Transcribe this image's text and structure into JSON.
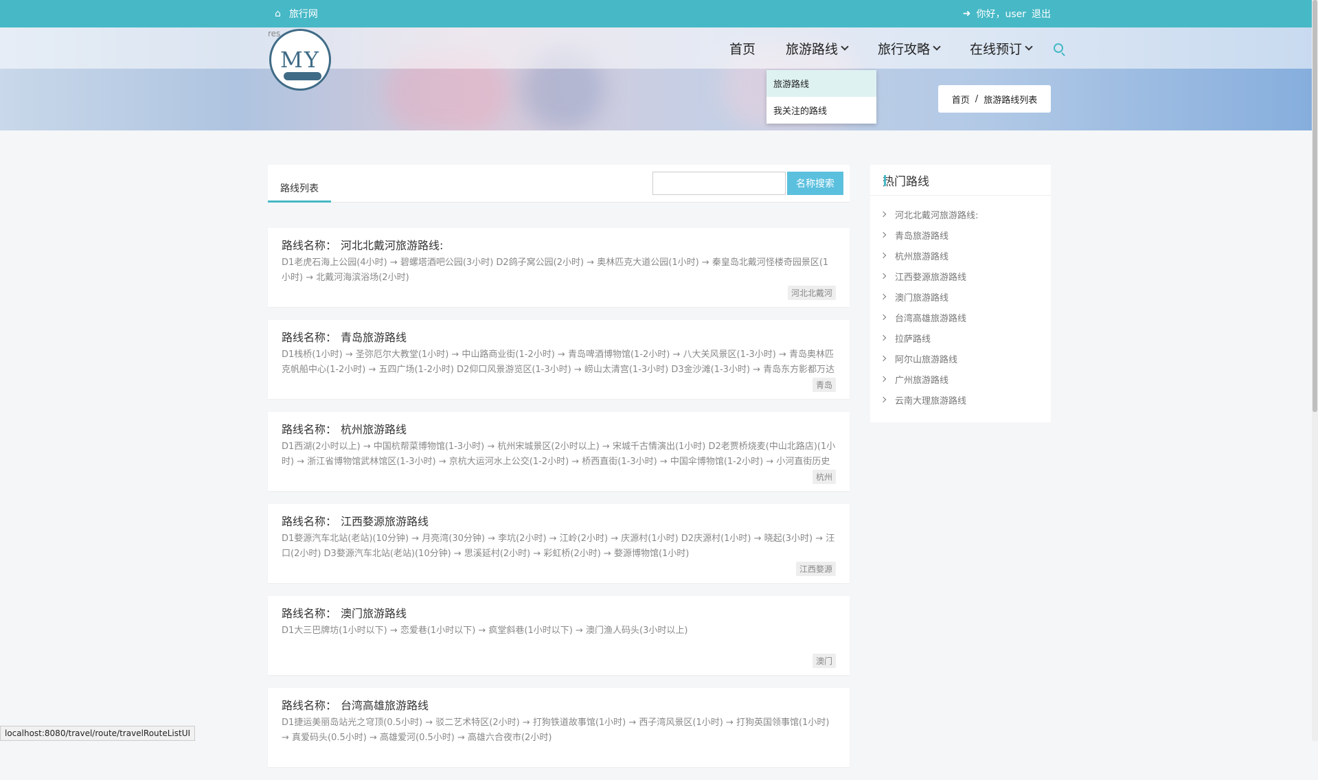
{
  "topbar": {
    "site_name": "旅行网",
    "greeting": "你好，user",
    "logout": "退出"
  },
  "logo": {
    "alt_text": "res",
    "mark": "MY"
  },
  "nav": {
    "home": "首页",
    "routes": "旅游路线",
    "guides": "旅行攻略",
    "booking": "在线预订"
  },
  "dropdown": {
    "options": [
      "旅游路线",
      "我关注的路线"
    ]
  },
  "breadcrumb": {
    "home": "首页",
    "separator": "/",
    "current": "旅游路线列表"
  },
  "main": {
    "tab": "路线列表",
    "search": {
      "placeholder": "",
      "button": "名称搜索"
    },
    "routes": [
      {
        "label": "路线名称：",
        "name": "河北北戴河旅游路线:",
        "desc": "D1老虎石海上公园(4小时) → 碧螺塔酒吧公园(3小时) D2鸽子窝公园(2小时) → 奥林匹克大道公园(1小时) → 秦皇岛北戴河怪楼奇园景区(1小时) → 北戴河海滨浴场(2小时)",
        "tag": "河北北戴河"
      },
      {
        "label": "路线名称：",
        "name": "青岛旅游路线",
        "desc": "D1栈桥(1小时) → 圣弥厄尔大教堂(1小时) → 中山路商业街(1-2小时) → 青岛啤酒博物馆(1-2小时) → 八大关风景区(1-3小时) → 青岛奥林匹克帆船中心(1-2小时) → 五四广场(1-2小时) D2仰口风景游览区(1-3小时) → 崂山太清宫(1-3小时) D3金沙滩(1-3小时) → 青岛东方影都万达乐园",
        "tag": "青岛"
      },
      {
        "label": "路线名称：",
        "name": "杭州旅游路线",
        "desc": "D1西湖(2小时以上) → 中国杭帮菜博物馆(1-3小时) → 杭州宋城景区(2小时以上) → 宋城千古情演出(1小时) D2老贾桥烧麦(中山北路店)(1小时) → 浙江省博物馆武林馆区(1-3小时) → 京杭大运河水上公交(1-2小时) → 桥西直街(1-3小时) → 中国伞博物馆(1-2小时) → 小河直街历史文",
        "tag": "杭州"
      },
      {
        "label": "路线名称：",
        "name": "江西婺源旅游路线",
        "desc": "D1婺源汽车北站(老站)(10分钟) → 月亮湾(30分钟) → 李坑(2小时) → 江岭(2小时) → 庆源村(1小时) D2庆源村(1小时) → 晓起(3小时) → 汪口(2小时) D3婺源汽车北站(老站)(10分钟) → 思溪延村(2小时) → 彩虹桥(2小时) → 婺源博物馆(1小时)",
        "tag": "江西婺源"
      },
      {
        "label": "路线名称：",
        "name": "澳门旅游路线",
        "desc": "D1大三巴牌坊(1小时以下) → 恋爱巷(1小时以下) → 疯堂斜巷(1小时以下) → 澳门渔人码头(3小时以上)",
        "tag": "澳门"
      },
      {
        "label": "路线名称：",
        "name": "台湾高雄旅游路线",
        "desc": "D1捷运美丽岛站光之穹顶(0.5小时) → 驳二艺术特区(2小时) → 打狗铁道故事馆(1小时) → 西子湾风景区(1小时) → 打狗英国领事馆(1小时) → 真爱码头(0.5小时) → 高雄爱河(0.5小时) → 高雄六合夜市(2小时)",
        "tag": ""
      }
    ]
  },
  "sidebar": {
    "title": "热门路线",
    "items": [
      "河北北戴河旅游路线:",
      "青岛旅游路线",
      "杭州旅游路线",
      "江西婺源旅游路线",
      "澳门旅游路线",
      "台湾高雄旅游路线",
      "拉萨路线",
      "阿尔山旅游路线",
      "广州旅游路线",
      "云南大理旅游路线"
    ]
  },
  "status_url": "localhost:8080/travel/route/travelRouteListUI",
  "colors": {
    "accent": "#46b8c6",
    "button": "#5bc0de"
  },
  "icons": {
    "home": "home-icon",
    "login": "sign-in-icon",
    "search": "search-icon"
  }
}
